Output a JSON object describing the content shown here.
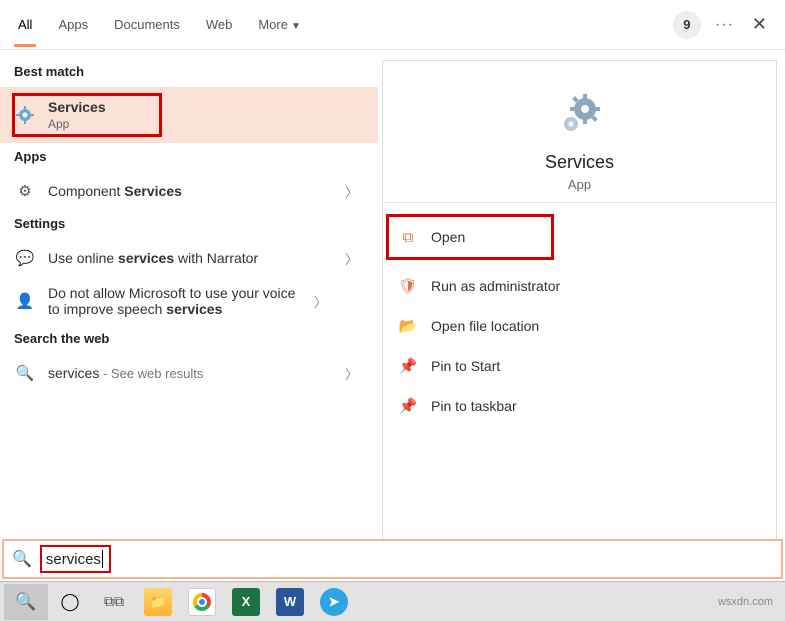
{
  "tabs": {
    "all": "All",
    "apps": "Apps",
    "documents": "Documents",
    "web": "Web",
    "more": "More"
  },
  "badge": "9",
  "sections": {
    "best": "Best match",
    "apps": "Apps",
    "settings": "Settings",
    "web": "Search the web"
  },
  "best": {
    "title": "Services",
    "sub": "App"
  },
  "app_result": {
    "prefix": "Component ",
    "bold": "Services"
  },
  "setting1": {
    "p1": "Use online ",
    "b1": "services",
    "p2": " with Narrator"
  },
  "setting2": {
    "p1": "Do not allow Microsoft to use your voice to improve speech ",
    "b1": "services"
  },
  "web_result": {
    "term": "services",
    "hint": " - See web results"
  },
  "detail": {
    "title": "Services",
    "sub": "App"
  },
  "actions": {
    "open": "Open",
    "admin": "Run as administrator",
    "loc": "Open file location",
    "pin_start": "Pin to Start",
    "pin_task": "Pin to taskbar"
  },
  "search": {
    "value": "services"
  },
  "watermark": "wsxdn.com"
}
